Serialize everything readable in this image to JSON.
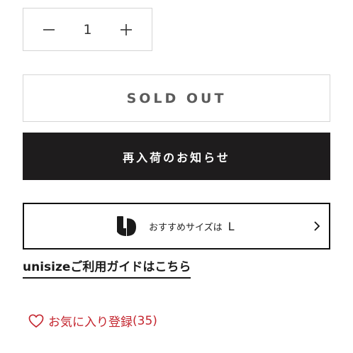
{
  "quantity": {
    "value": "1",
    "minus_icon": "minus-icon",
    "plus_icon": "plus-icon"
  },
  "sold_out_label": "SOLD OUT",
  "restock_label": "再入荷のお知らせ",
  "unisize": {
    "logo_icon": "unisize-logo-icon",
    "recommend_text": "おすすめサイズは",
    "size_value": "L",
    "arrow_icon": "chevron-right-icon"
  },
  "guide_link": "unisizeご利用ガイドはこちら",
  "favorite": {
    "icon": "heart-icon",
    "label": "お気に入り登録",
    "count": "(35)",
    "color": "#c4262f"
  },
  "colors": {
    "restock_bg": "#1e1c1d",
    "sold_out_text": "#5b5b5b",
    "border": "#d4d4d4"
  }
}
